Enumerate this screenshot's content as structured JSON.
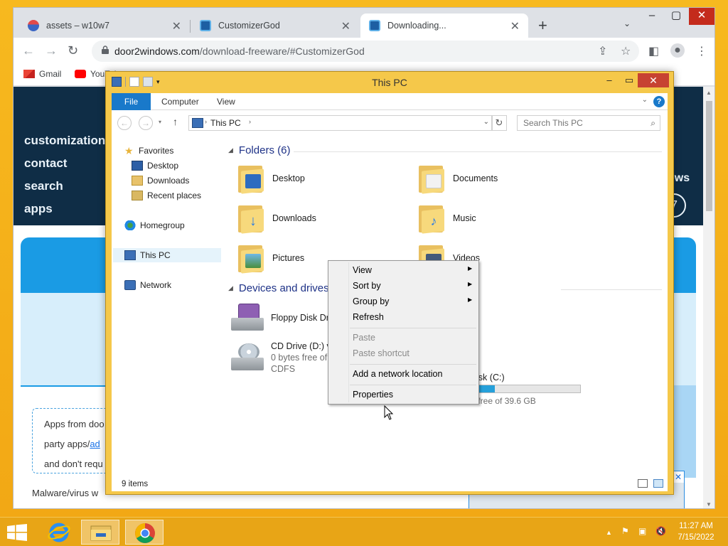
{
  "browser": {
    "tabs": [
      {
        "label": "assets – w10w7",
        "active": false
      },
      {
        "label": "CustomizerGod",
        "active": false
      },
      {
        "label": "Downloading...",
        "active": true
      }
    ],
    "url_domain": "door2windows.com",
    "url_path": "/download-freeware/#CustomizerGod",
    "bookmarks": [
      "Gmail",
      "YouTube"
    ]
  },
  "webpage": {
    "nav_links": [
      "customization",
      "contact",
      "search",
      "apps"
    ],
    "right_fragment": "ows",
    "circle_digit": "7",
    "info_lines": [
      "Apps from doo",
      "party apps/ad",
      "and don't requ"
    ],
    "info_link": "ad",
    "info_prefix": "party apps/",
    "malware_text": "Malware/virus w"
  },
  "explorer": {
    "title": "This PC",
    "ribbon_tabs": [
      "File",
      "Computer",
      "View"
    ],
    "help": "?",
    "address": "This PC",
    "search_placeholder": "Search This PC",
    "nav": {
      "favorites": "Favorites",
      "favorites_items": [
        "Desktop",
        "Downloads",
        "Recent places"
      ],
      "homegroup": "Homegroup",
      "this_pc": "This PC",
      "network": "Network"
    },
    "folders_header": "Folders (6)",
    "folders": [
      "Desktop",
      "Documents",
      "Downloads",
      "Music",
      "Pictures",
      "Videos"
    ],
    "devices_header": "Devices and drives",
    "drives": [
      {
        "name": "Floppy Disk Dr",
        "sub1": "",
        "sub2": ""
      },
      {
        "name": "CD Drive (D:) v",
        "sub1": "0 bytes free of",
        "sub2": "CDFS"
      }
    ],
    "local_disk": {
      "name": "Disk (C:)",
      "free": "B free of 39.6 GB",
      "used_fraction": 0.22
    },
    "status": "9 items"
  },
  "context_menu": {
    "items": [
      "View",
      "Sort by",
      "Group by",
      "Refresh",
      "Paste",
      "Paste shortcut",
      "Add a network location",
      "Properties"
    ]
  },
  "taskbar": {
    "time": "11:27 AM",
    "date": "7/15/2022"
  },
  "colors": {
    "accent_blue": "#1979ca",
    "desktop_orange": "#f6b21c",
    "web_navy": "#0f2d46",
    "web_blue": "#1a9be4"
  }
}
